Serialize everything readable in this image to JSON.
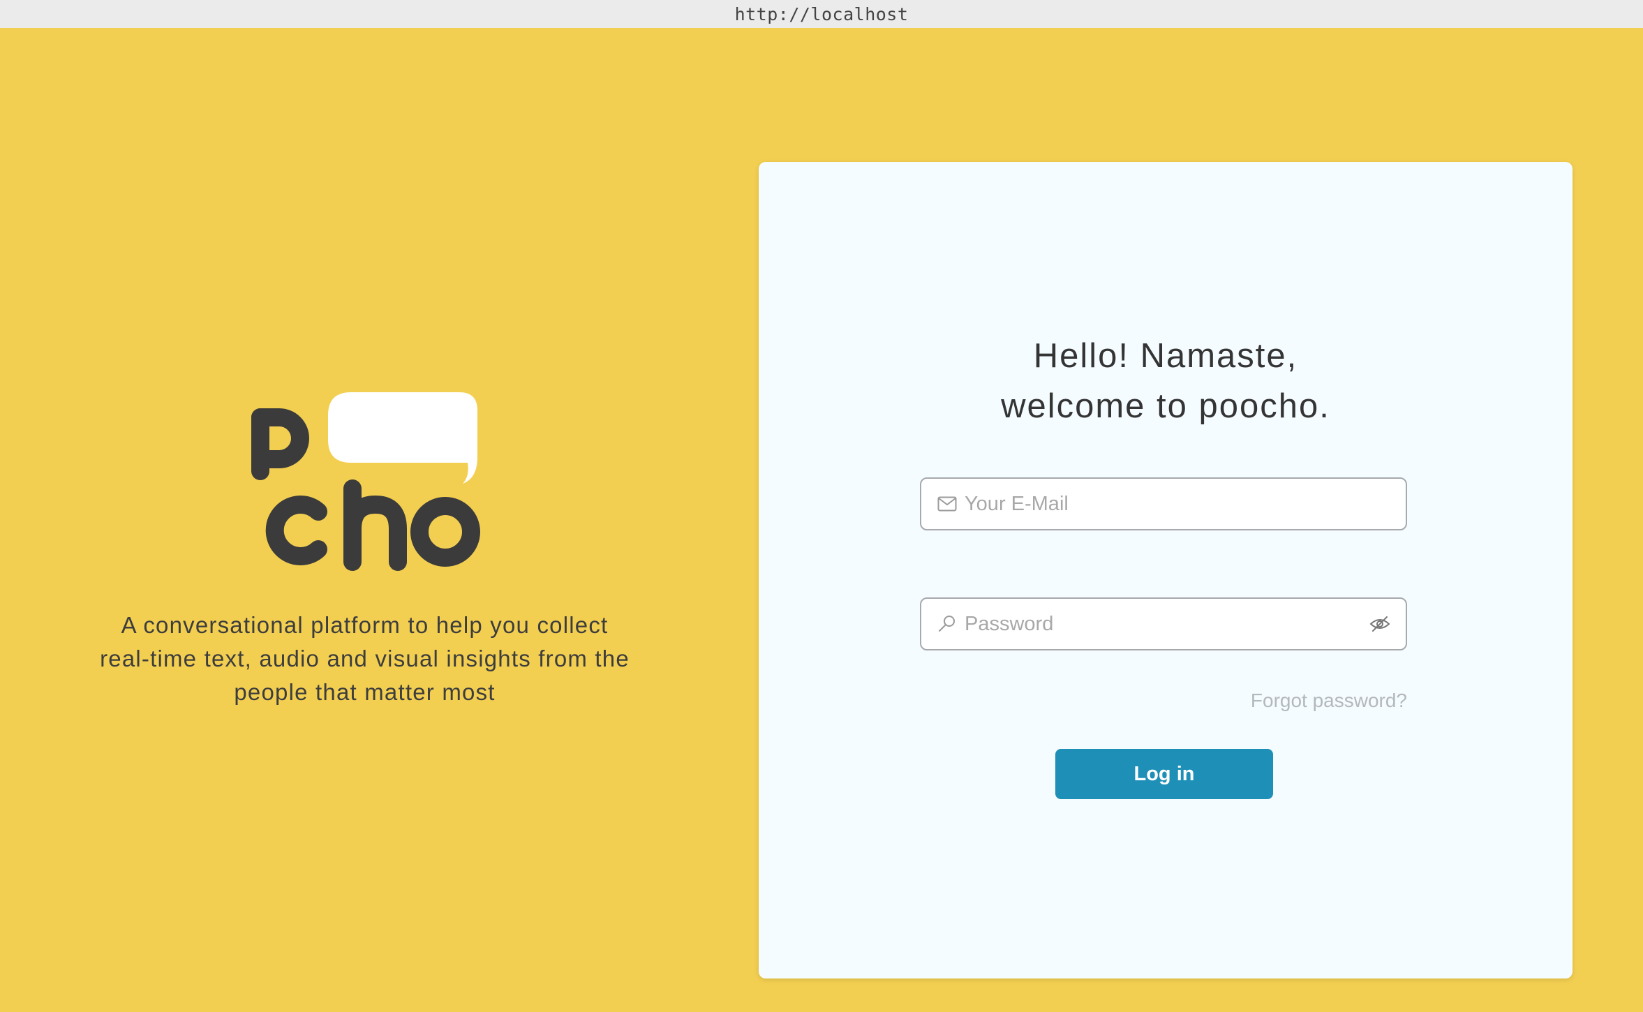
{
  "browser": {
    "url": "http://localhost"
  },
  "brand": {
    "logo_text": "poocho",
    "tagline_lines": [
      "A conversational platform to help you collect",
      "real-time text, audio and visual insights from the",
      "people that matter most"
    ]
  },
  "login": {
    "greeting_lines": [
      "Hello! Namaste,",
      "welcome to poocho."
    ],
    "email": {
      "value": "",
      "placeholder": "Your E-Mail",
      "icon": "envelope-icon"
    },
    "password": {
      "value": "",
      "placeholder": "Password",
      "icon": "key-icon",
      "toggle_icon": "eye-slash-icon"
    },
    "forgot_label": "Forgot password?",
    "submit_label": "Log in"
  },
  "colors": {
    "background": "#f3cf51",
    "card": "#f5fcff",
    "button": "#1e8fb7",
    "logo_dark": "#3b3b3b",
    "logo_bubble": "#ffffff"
  }
}
